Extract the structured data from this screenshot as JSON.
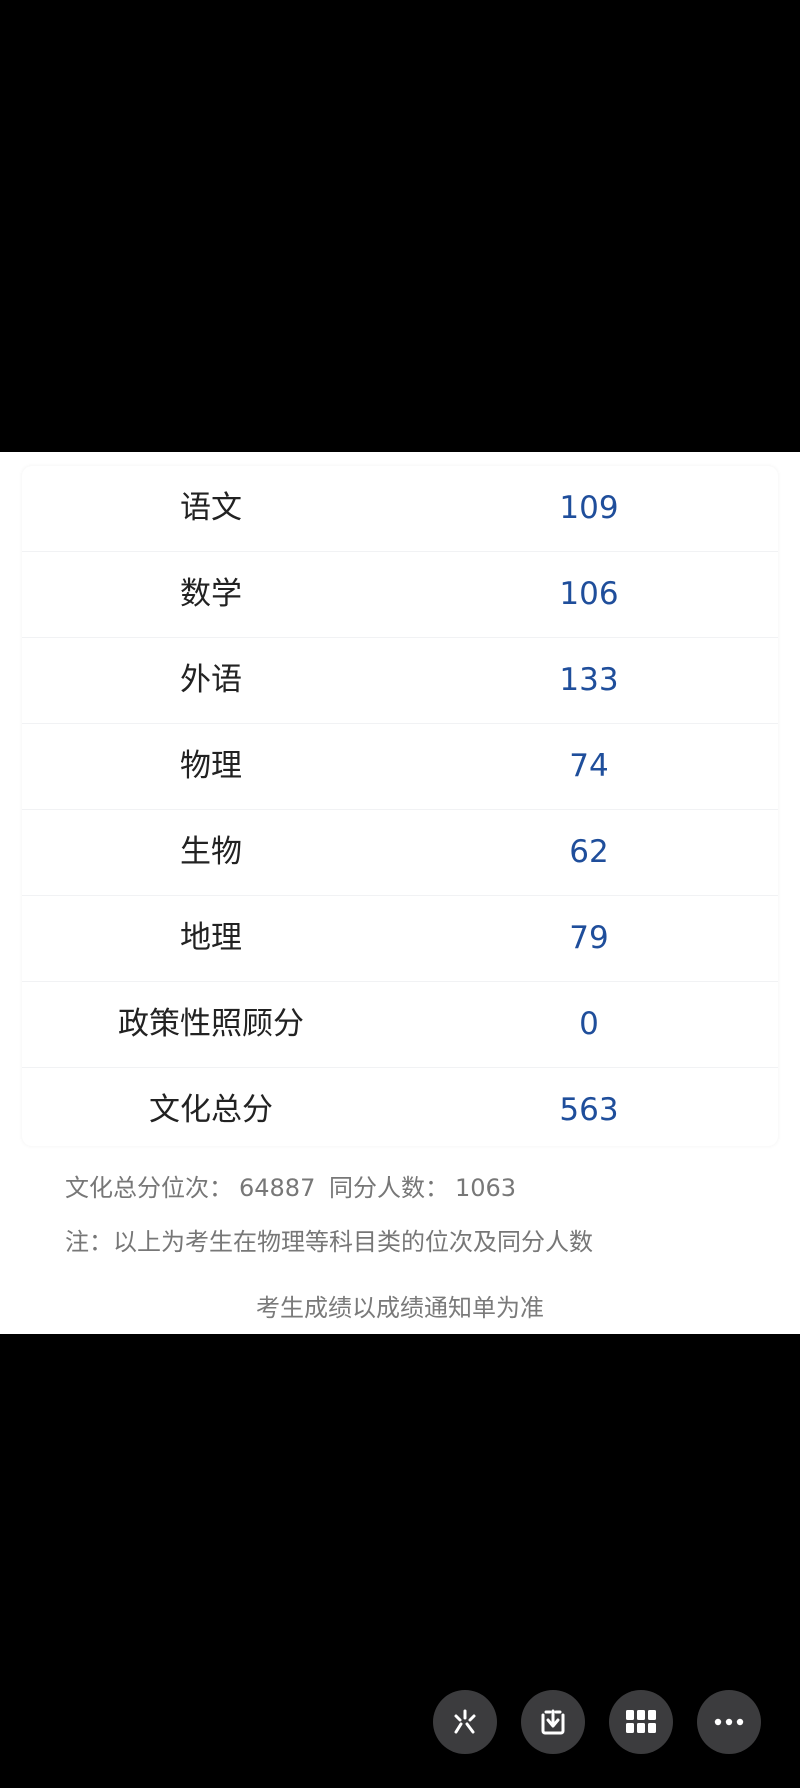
{
  "scores": [
    {
      "subject": "语文",
      "score": "109"
    },
    {
      "subject": "数学",
      "score": "106"
    },
    {
      "subject": "外语",
      "score": "133"
    },
    {
      "subject": "物理",
      "score": "74"
    },
    {
      "subject": "生物",
      "score": "62"
    },
    {
      "subject": "地理",
      "score": "79"
    },
    {
      "subject": "政策性照顾分",
      "score": "0"
    },
    {
      "subject": "文化总分",
      "score": "563"
    }
  ],
  "rank": {
    "rank_label": "文化总分位次：",
    "rank_value": "64887",
    "same_label": "同分人数：",
    "same_value": "1063"
  },
  "note": "注：以上为考生在物理等科目类的位次及同分人数",
  "disclaimer": "考生成绩以成绩通知单为准",
  "toolbar": {
    "icons": [
      "sparkle-icon",
      "download-icon",
      "grid-icon",
      "more-icon"
    ]
  },
  "colors": {
    "score_blue": "#1f4e9b",
    "background": "#000000",
    "panel": "#ffffff"
  }
}
